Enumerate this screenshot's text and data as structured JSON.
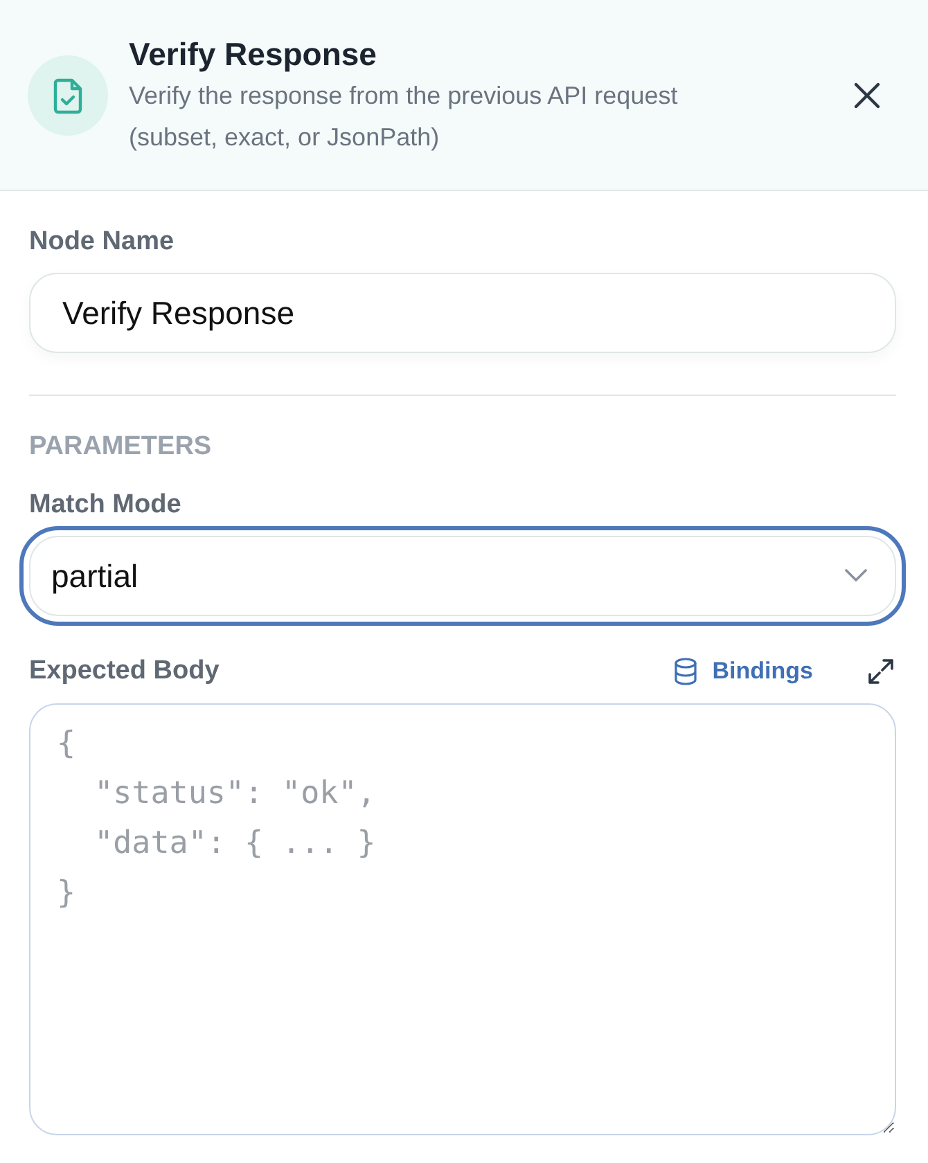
{
  "header": {
    "title": "Verify Response",
    "description": "Verify the response from the previous API request (subset, exact, or JsonPath)"
  },
  "node_name": {
    "label": "Node Name",
    "value": "Verify Response"
  },
  "parameters": {
    "heading": "PARAMETERS",
    "match_mode": {
      "label": "Match Mode",
      "value": "partial",
      "focused": true
    },
    "expected_body": {
      "label": "Expected Body",
      "bindings_link": "Bindings",
      "placeholder": "{\n  \"status\": \"ok\",\n  \"data\": { ... }\n}"
    }
  }
}
